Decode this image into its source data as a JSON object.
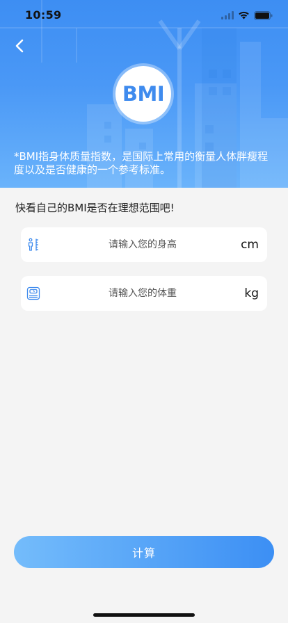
{
  "status_bar": {
    "time": "10:59"
  },
  "header": {
    "back_icon": "chevron-left-icon",
    "badge_text": "BMI",
    "description": "*BMI指身体质量指数，是国际上常用的衡量人体胖瘦程度以及是否健康的一个参考标准。"
  },
  "main": {
    "prompt": "快看自己的BMI是否在理想范围吧!",
    "height_field": {
      "icon": "height-ruler-icon",
      "placeholder": "请输入您的身高",
      "value": "",
      "unit": "cm"
    },
    "weight_field": {
      "icon": "weight-scale-icon",
      "placeholder": "请输入您的体重",
      "value": "",
      "unit": "kg"
    },
    "calculate_label": "计算"
  },
  "colors": {
    "header_blue": "#4a98f6",
    "accent_blue": "#3f8bee",
    "button_gradient_start": "#74bcfb",
    "button_gradient_end": "#3c8ff4",
    "page_background": "#f4f4f4"
  }
}
